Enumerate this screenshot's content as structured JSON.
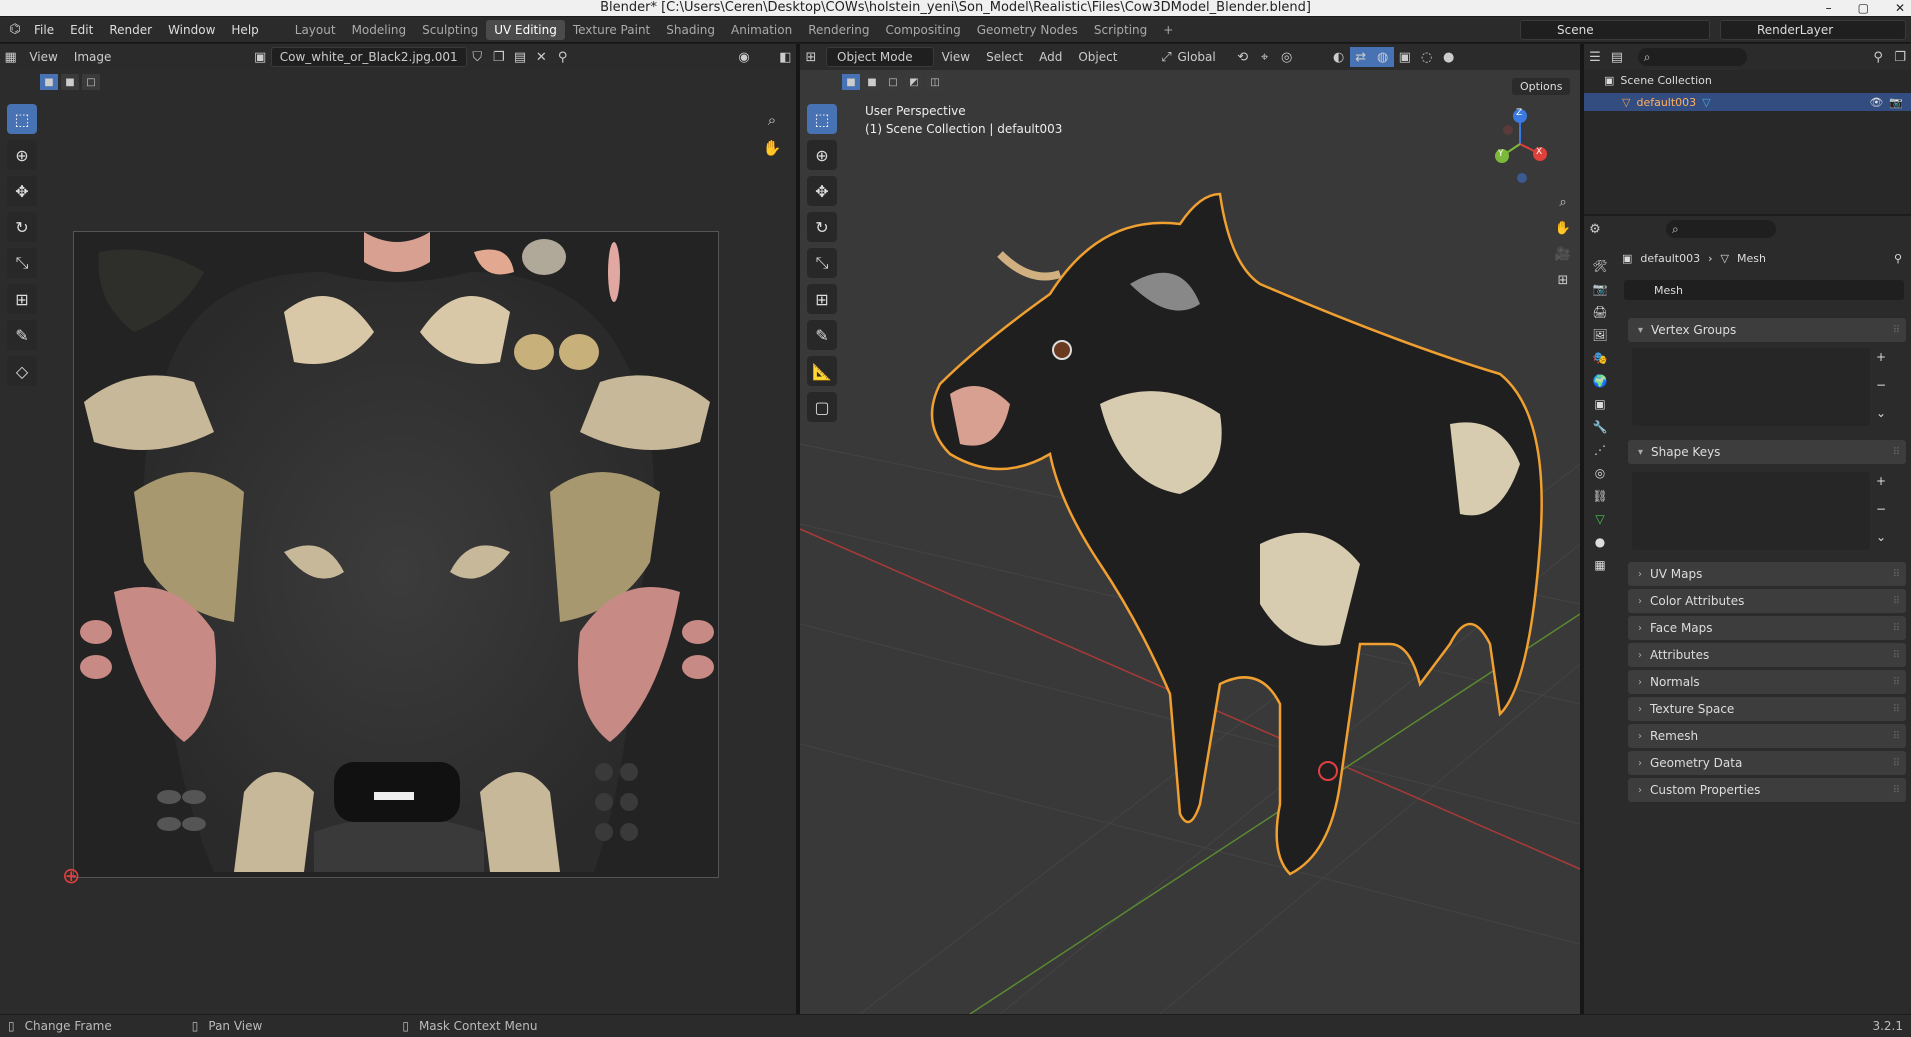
{
  "window_title": "Blender* [C:\\Users\\Ceren\\Desktop\\COWs\\holstein_yeni\\Son_Model\\Realistic\\Files\\Cow3DModel_Blender.blend]",
  "window_buttons": [
    "–",
    "▢",
    "✕"
  ],
  "menu": [
    "File",
    "Edit",
    "Render",
    "Window",
    "Help"
  ],
  "workspaces": [
    "Layout",
    "Modeling",
    "Sculpting",
    "UV Editing",
    "Texture Paint",
    "Shading",
    "Animation",
    "Rendering",
    "Compositing",
    "Geometry Nodes",
    "Scripting",
    "+"
  ],
  "active_workspace": "UV Editing",
  "scene_name": "Scene",
  "view_layer": "RenderLayer",
  "uv_editor": {
    "menu": [
      "View",
      "Image"
    ],
    "image_name": "Cow_white_or_Black2.jpg.001"
  },
  "viewport": {
    "mode": "Object Mode",
    "menu": [
      "View",
      "Select",
      "Add",
      "Object"
    ],
    "transform_orientation": "Global",
    "options_label": "Options",
    "perspective_label": "User Perspective",
    "collection_label": "(1) Scene Collection | default003",
    "gizmo_axes": [
      "Z",
      "Y",
      "X"
    ]
  },
  "outliner": {
    "root": "Scene Collection",
    "items": [
      "default003"
    ]
  },
  "properties": {
    "breadcrumb_object": "default003",
    "breadcrumb_data": "Mesh",
    "data_name": "Mesh",
    "panels": [
      "Vertex Groups",
      "Shape Keys",
      "UV Maps",
      "Color Attributes",
      "Face Maps",
      "Attributes",
      "Normals",
      "Texture Space",
      "Remesh",
      "Geometry Data",
      "Custom Properties"
    ]
  },
  "status": {
    "items": [
      "Change Frame",
      "Pan View",
      "Mask Context Menu"
    ],
    "version": "3.2.1"
  },
  "colors": {
    "accent": "#4772b3",
    "selection_outline": "#f0a030",
    "axis_x": "#e0403a",
    "axis_y": "#7cb83a",
    "axis_z": "#3a7ae0"
  }
}
